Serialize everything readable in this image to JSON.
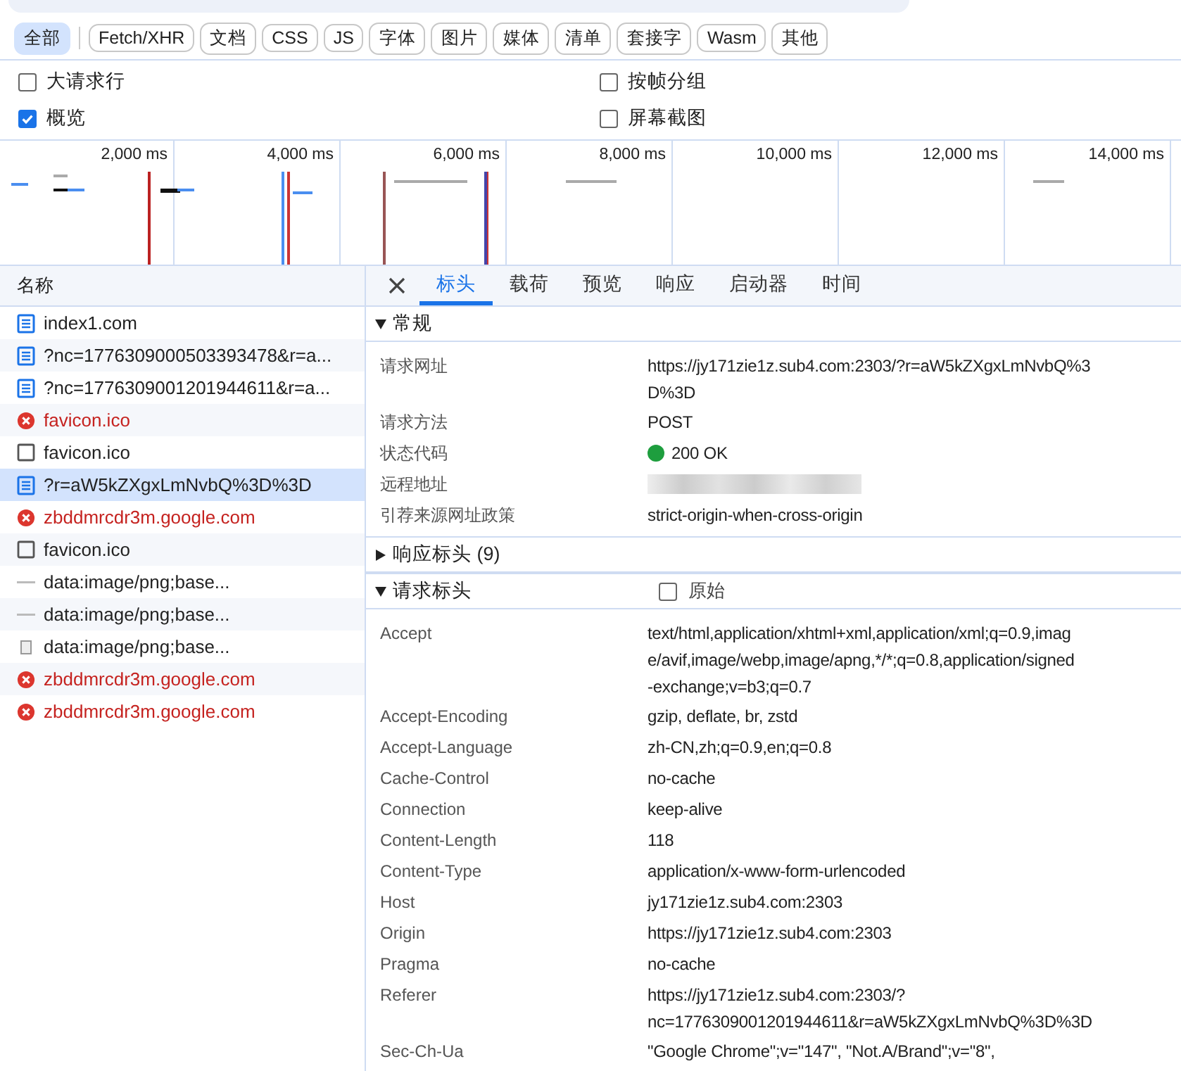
{
  "filter_types": [
    {
      "label": "全部",
      "selected": true
    },
    {
      "label": "Fetch/XHR",
      "selected": false
    },
    {
      "label": "文档",
      "selected": false
    },
    {
      "label": "CSS",
      "selected": false
    },
    {
      "label": "JS",
      "selected": false
    },
    {
      "label": "字体",
      "selected": false
    },
    {
      "label": "图片",
      "selected": false
    },
    {
      "label": "媒体",
      "selected": false
    },
    {
      "label": "清单",
      "selected": false
    },
    {
      "label": "套接字",
      "selected": false
    },
    {
      "label": "Wasm",
      "selected": false
    },
    {
      "label": "其他",
      "selected": false
    }
  ],
  "options_left": [
    {
      "label": "大请求行",
      "checked": false
    },
    {
      "label": "概览",
      "checked": true
    }
  ],
  "options_right": [
    {
      "label": "按帧分组",
      "checked": false
    },
    {
      "label": "屏幕截图",
      "checked": false
    }
  ],
  "overview": {
    "ticks": [
      "2,000 ms",
      "4,000 ms",
      "6,000 ms",
      "8,000 ms",
      "10,000 ms",
      "12,000 ms",
      "14,000 ms"
    ]
  },
  "requests": {
    "header": "名称",
    "rows": [
      {
        "name": "index1.com",
        "kind": "document",
        "selected": false
      },
      {
        "name": "?nc=1776309000503393478&r=a...",
        "kind": "document",
        "selected": false
      },
      {
        "name": "?nc=1776309001201944611&r=a...",
        "kind": "document",
        "selected": false
      },
      {
        "name": "favicon.ico",
        "kind": "error",
        "selected": false
      },
      {
        "name": "favicon.ico",
        "kind": "blank",
        "selected": false
      },
      {
        "name": "?r=aW5kZXgxLmNvbQ%3D%3D",
        "kind": "document",
        "selected": true
      },
      {
        "name": "zbddmrcdr3m.google.com",
        "kind": "error",
        "selected": false
      },
      {
        "name": "favicon.ico",
        "kind": "blank",
        "selected": false
      },
      {
        "name": "data:image/png;base...",
        "kind": "dash",
        "selected": false
      },
      {
        "name": "data:image/png;base...",
        "kind": "dash",
        "selected": false
      },
      {
        "name": "data:image/png;base...",
        "kind": "file",
        "selected": false
      },
      {
        "name": "zbddmrcdr3m.google.com",
        "kind": "error",
        "selected": false
      },
      {
        "name": "zbddmrcdr3m.google.com",
        "kind": "error",
        "selected": false
      }
    ]
  },
  "detail_tabs": [
    {
      "label": "标头",
      "selected": true
    },
    {
      "label": "载荷",
      "selected": false
    },
    {
      "label": "预览",
      "selected": false
    },
    {
      "label": "响应",
      "selected": false
    },
    {
      "label": "启动器",
      "selected": false
    },
    {
      "label": "时间",
      "selected": false
    }
  ],
  "sections": [
    {
      "title": "常规",
      "expanded": true,
      "rows": [
        {
          "name": "请求网址",
          "kind": "text",
          "lines": [
            "https://jy171zie1z.sub4.com:2303/?r=aW5kZXgxLmNvbQ%3",
            "D%3D"
          ]
        },
        {
          "name": "请求方法",
          "kind": "text",
          "lines": [
            "POST"
          ]
        },
        {
          "name": "状态代码",
          "kind": "status",
          "color": "#1e9e3e",
          "lines": [
            "200 OK"
          ]
        },
        {
          "name": "远程地址",
          "kind": "blurred"
        },
        {
          "name": "引荐来源网址政策",
          "kind": "text",
          "lines": [
            "strict-origin-when-cross-origin"
          ]
        }
      ]
    },
    {
      "title": "响应标头 (9)",
      "expanded": false
    },
    {
      "title": "请求标头",
      "expanded": true,
      "raw": {
        "label": "原始",
        "checked": false
      },
      "rows": [
        {
          "name": "Accept",
          "kind": "text",
          "lines": [
            "text/html,application/xhtml+xml,application/xml;q=0.9,imag",
            "e/avif,image/webp,image/apng,*/*;q=0.8,application/signed",
            "-exchange;v=b3;q=0.7"
          ]
        },
        {
          "name": "Accept-Encoding",
          "kind": "text",
          "lines": [
            "gzip, deflate, br, zstd"
          ]
        },
        {
          "name": "Accept-Language",
          "kind": "text",
          "lines": [
            "zh-CN,zh;q=0.9,en;q=0.8"
          ]
        },
        {
          "name": "Cache-Control",
          "kind": "text",
          "lines": [
            "no-cache"
          ]
        },
        {
          "name": "Connection",
          "kind": "text",
          "lines": [
            "keep-alive"
          ]
        },
        {
          "name": "Content-Length",
          "kind": "text",
          "lines": [
            "118"
          ]
        },
        {
          "name": "Content-Type",
          "kind": "text",
          "lines": [
            "application/x-www-form-urlencoded"
          ]
        },
        {
          "name": "Host",
          "kind": "text",
          "lines": [
            "jy171zie1z.sub4.com:2303"
          ]
        },
        {
          "name": "Origin",
          "kind": "text",
          "lines": [
            "https://jy171zie1z.sub4.com:2303"
          ]
        },
        {
          "name": "Pragma",
          "kind": "text",
          "lines": [
            "no-cache"
          ]
        },
        {
          "name": "Referer",
          "kind": "text",
          "lines": [
            "https://jy171zie1z.sub4.com:2303/?",
            "nc=1776309001201944611&r=aW5kZXgxLmNvbQ%3D%3D"
          ]
        },
        {
          "name": "Sec-Ch-Ua",
          "kind": "text",
          "lines": [
            "\"Google Chrome\";v=\"147\", \"Not.A/Brand\";v=\"8\","
          ]
        }
      ]
    }
  ]
}
